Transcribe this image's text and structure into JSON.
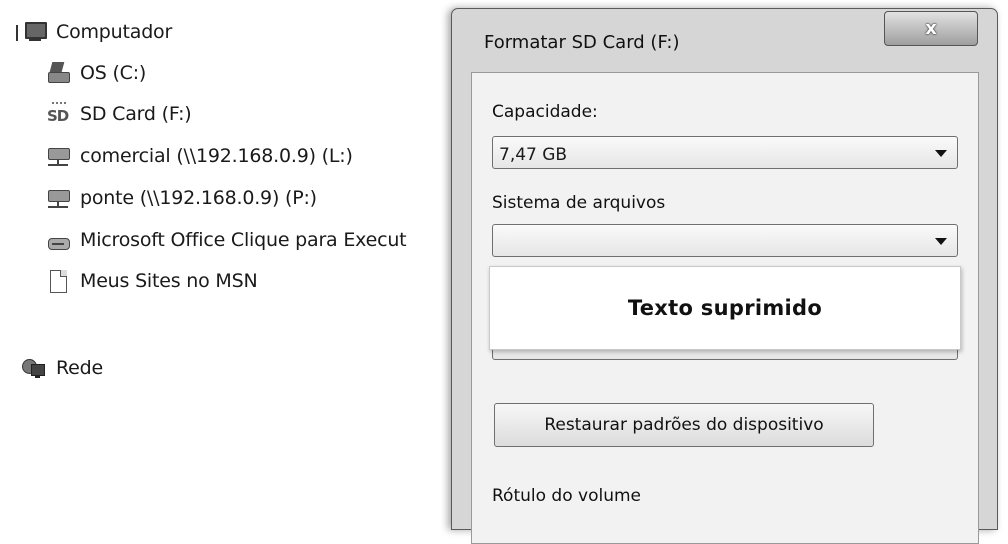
{
  "nav": {
    "computer_label": "Computador",
    "items": [
      {
        "label": "OS (C:)",
        "icon": "drive-icon"
      },
      {
        "label": "SD Card (F:)",
        "icon": "sd-card-icon"
      },
      {
        "label": "comercial (\\\\192.168.0.9) (L:)",
        "icon": "network-drive-icon"
      },
      {
        "label": "ponte (\\\\192.168.0.9) (P:)",
        "icon": "network-drive-icon"
      },
      {
        "label": "Microsoft Office Clique para Execut",
        "icon": "disc-drive-icon"
      },
      {
        "label": "Meus Sites no MSN",
        "icon": "page-icon"
      }
    ],
    "network_label": "Rede"
  },
  "dialog": {
    "title": "Formatar SD Card (F:)",
    "close_glyph": "x",
    "capacity_label": "Capacidade:",
    "capacity_value": "7,47 GB",
    "filesystem_label": "Sistema de arquivos",
    "filesystem_value": "",
    "suppressed_text": "Texto suprimido",
    "restore_button": "Restaurar padrões do dispositivo",
    "volume_label": "Rótulo do volume"
  }
}
